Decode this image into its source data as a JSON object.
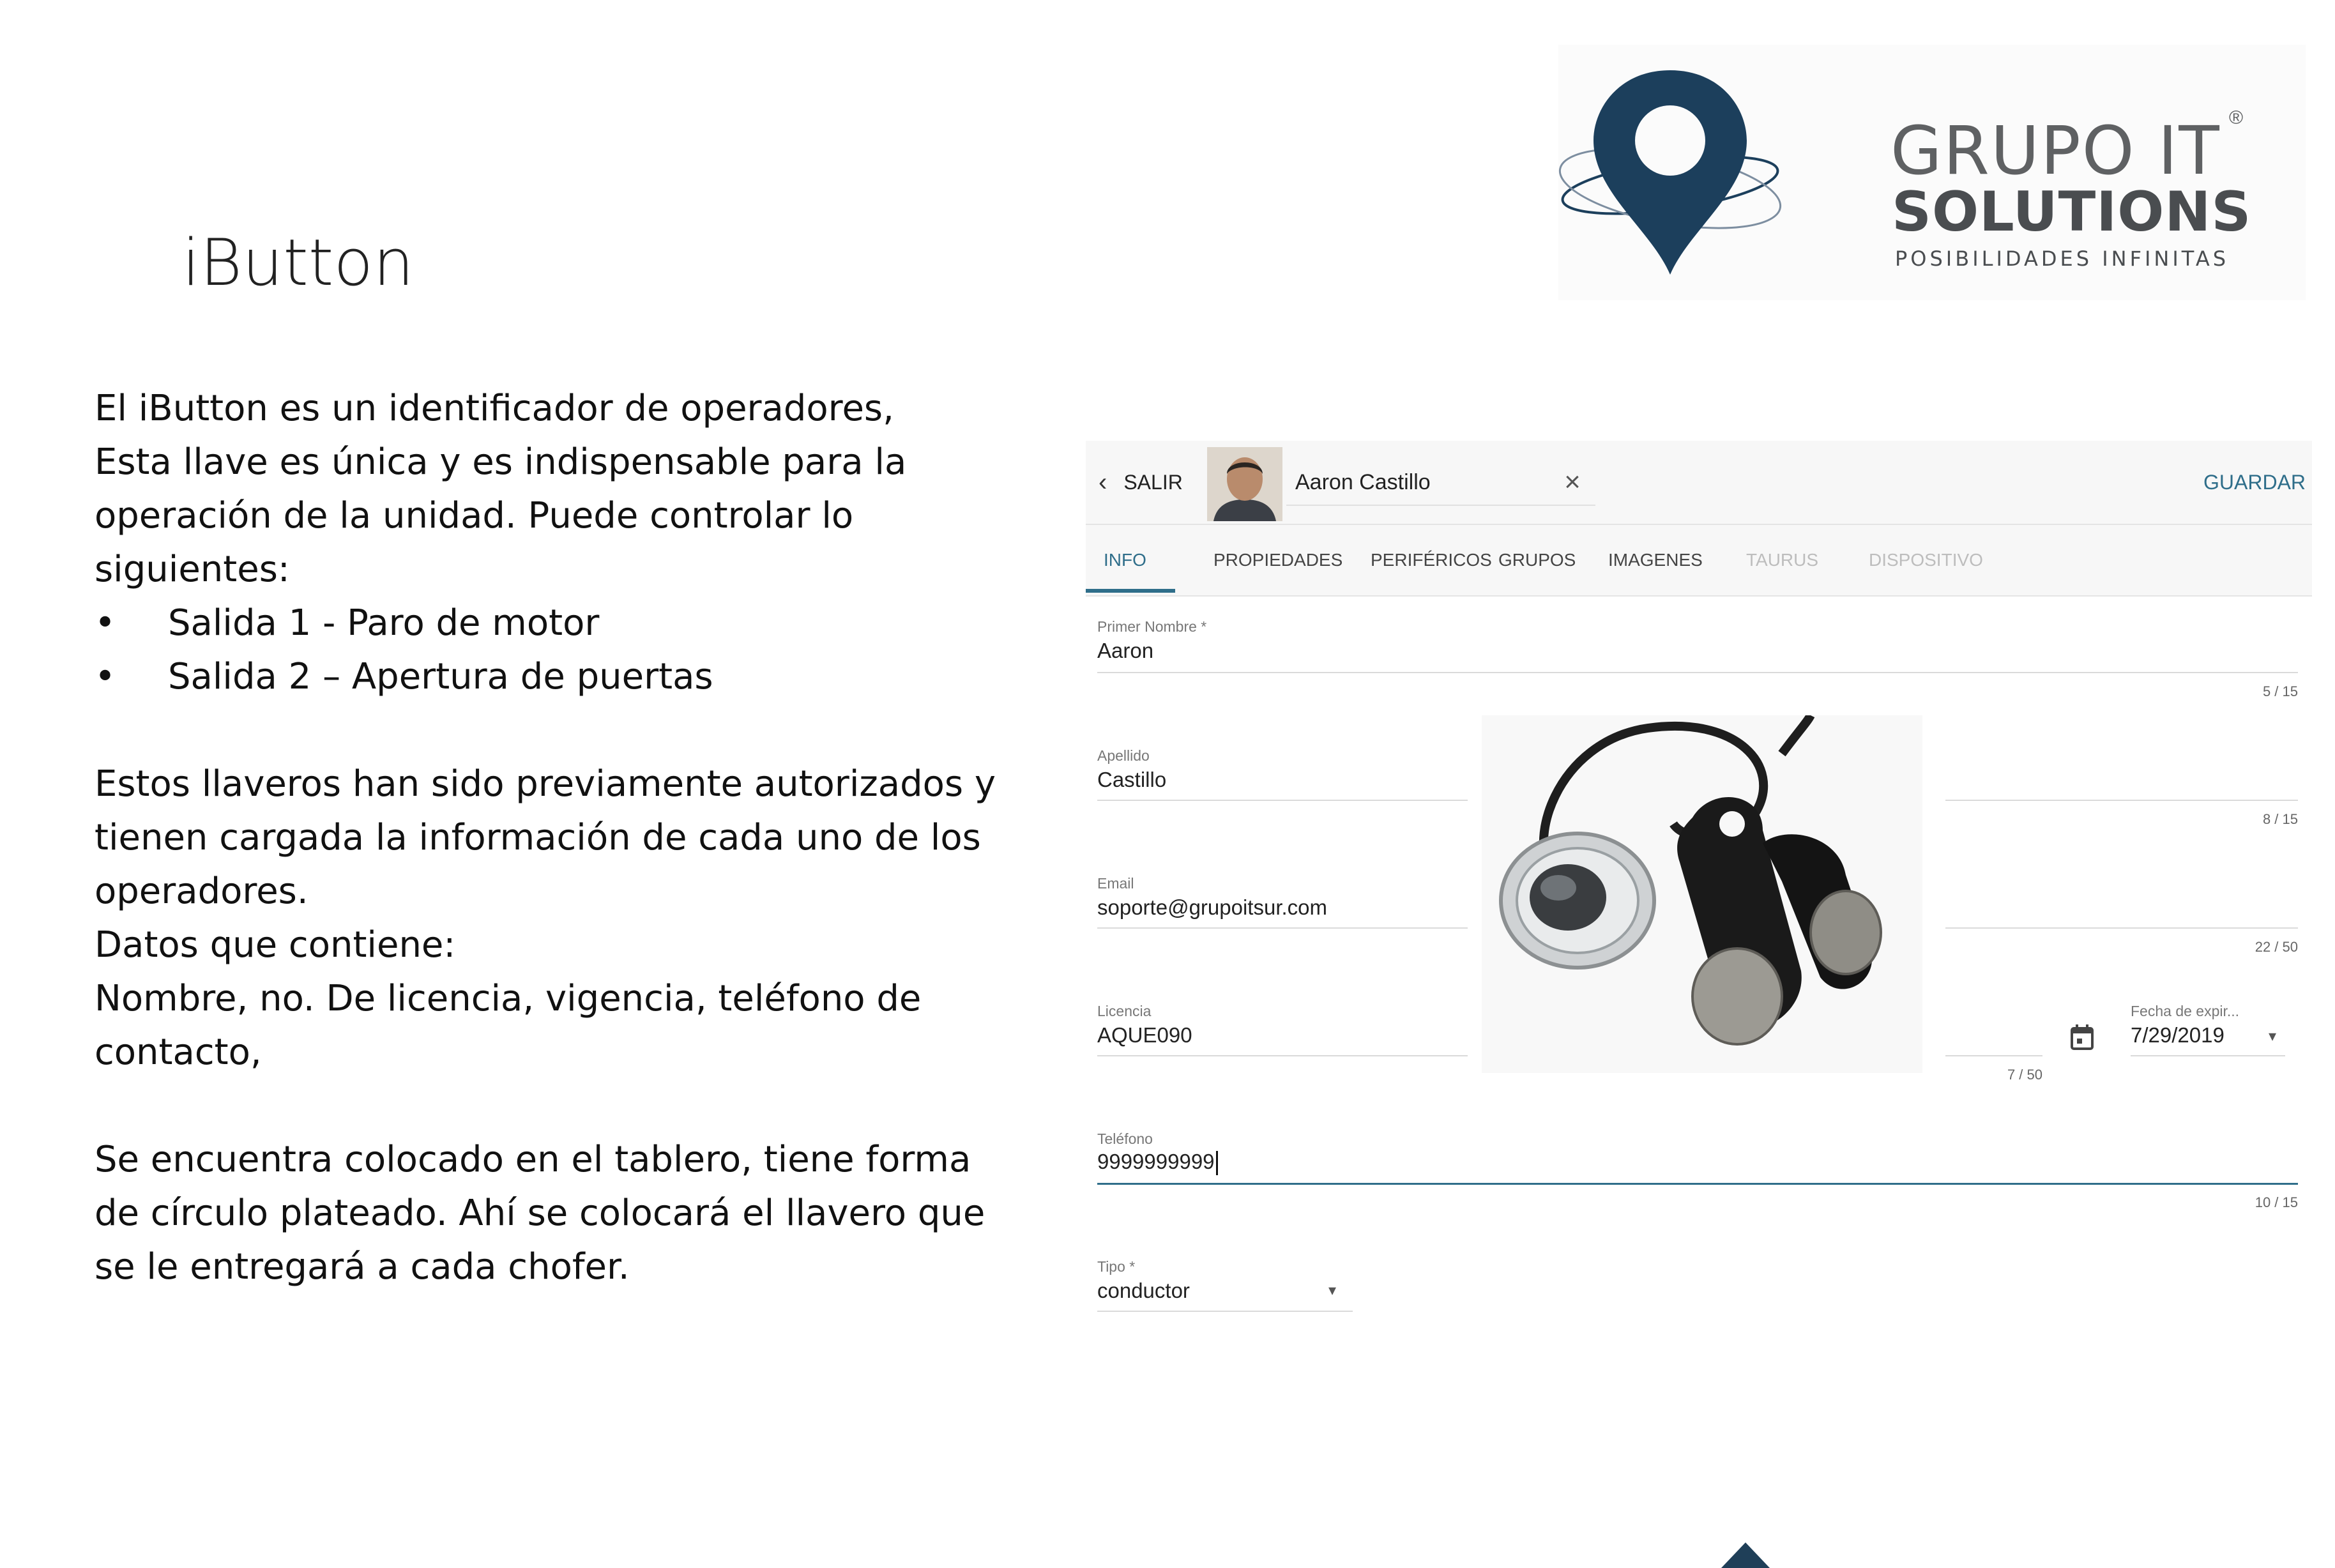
{
  "slide": {
    "title": "iButton",
    "paragraphs": [
      "El iButton es un identificador de operadores,",
      "Esta llave es única y es indispensable para la",
      "operación de la unidad. Puede controlar lo",
      "siguientes:"
    ],
    "bullets": [
      "Salida 1 - Paro de motor",
      "Salida 2 – Apertura de puertas"
    ],
    "bullet_char": "•",
    "paragraph2": [
      "Estos llaveros han sido previamente autorizados y",
      "tienen cargada la información de cada uno de los",
      "operadores.",
      "Datos que contiene:",
      "Nombre, no. De licencia, vigencia, teléfono de",
      "contacto,"
    ],
    "paragraph3": [
      "Se encuentra colocado en el tablero, tiene forma",
      "de círculo plateado.  Ahí se colocará el llavero que",
      "se le entregará a cada chofer."
    ]
  },
  "logo": {
    "line1": "GRUPO IT",
    "registered": "®",
    "line2": "SOLUTIONS",
    "line3": "POSIBILIDADES INFINITAS",
    "colors": {
      "pin": "#1c3f5c",
      "text": "#5f6163"
    }
  },
  "app": {
    "back_label": "SALIR",
    "back_icon": "chevron-left-icon",
    "driver_name": "Aaron Castillo",
    "clear_icon": "close-icon",
    "save_label": "GUARDAR",
    "accent_color": "#2f6e8a",
    "tabs": [
      {
        "label": "INFO",
        "state": "active"
      },
      {
        "label": "PROPIEDADES",
        "state": "normal"
      },
      {
        "label": "PERIFÉRICOS",
        "state": "normal"
      },
      {
        "label": "GRUPOS",
        "state": "normal"
      },
      {
        "label": "IMAGENES",
        "state": "normal"
      },
      {
        "label": "TAURUS",
        "state": "disabled"
      },
      {
        "label": "DISPOSITIVO",
        "state": "disabled"
      }
    ],
    "fields": {
      "first_name": {
        "label": "Primer Nombre *",
        "value": "Aaron",
        "counter": "5 / 15"
      },
      "last_name": {
        "label": "Apellido",
        "value": "Castillo",
        "counter": "8 / 15"
      },
      "email": {
        "label": "Email",
        "value": "soporte@grupoitsur.com",
        "counter": "22 / 50"
      },
      "license": {
        "label": "Licencia",
        "value": "AQUE090",
        "counter": "7 / 50"
      },
      "expiry": {
        "label": "Fecha de expir...",
        "value": "7/29/2019",
        "icon": "calendar-icon"
      },
      "phone": {
        "label": "Teléfono",
        "value": "9999999999",
        "counter": "10 / 15"
      },
      "type": {
        "label": "Tipo *",
        "value": "conductor"
      }
    }
  }
}
